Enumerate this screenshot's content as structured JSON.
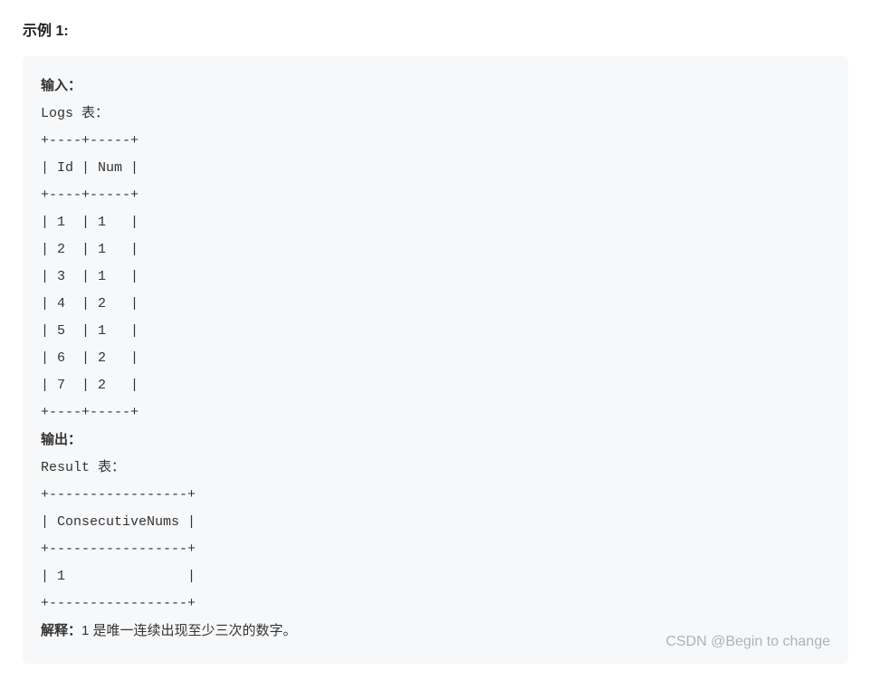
{
  "title": "示例 1:",
  "labels": {
    "input": "输入：",
    "output": "输出：",
    "explain": "解释："
  },
  "input_table": {
    "name": "Logs 表：",
    "border_top": "+----+-----+",
    "header": "| Id | Num |",
    "rows": [
      "| 1  | 1   |",
      "| 2  | 1   |",
      "| 3  | 1   |",
      "| 4  | 2   |",
      "| 5  | 1   |",
      "| 6  | 2   |",
      "| 7  | 2   |"
    ]
  },
  "output_table": {
    "name": "Result 表：",
    "border": "+-----------------+",
    "header": "| ConsecutiveNums |",
    "rows": [
      "| 1               |"
    ]
  },
  "explanation": "1 是唯一连续出现至少三次的数字。",
  "watermark": "CSDN @Begin to change",
  "chart_data": {
    "type": "table",
    "input": {
      "name": "Logs",
      "columns": [
        "Id",
        "Num"
      ],
      "rows": [
        [
          1,
          1
        ],
        [
          2,
          1
        ],
        [
          3,
          1
        ],
        [
          4,
          2
        ],
        [
          5,
          1
        ],
        [
          6,
          2
        ],
        [
          7,
          2
        ]
      ]
    },
    "output": {
      "name": "Result",
      "columns": [
        "ConsecutiveNums"
      ],
      "rows": [
        [
          1
        ]
      ]
    }
  }
}
